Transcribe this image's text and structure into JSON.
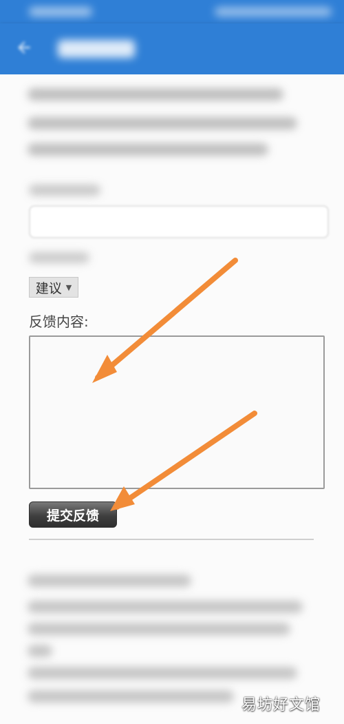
{
  "form": {
    "feedback_type_selected": "建议",
    "feedback_label": "反馈内容:",
    "submit_label": "提交反馈"
  },
  "watermark": "易坊好文馆",
  "colors": {
    "app_bar": "#2f7fd6",
    "arrow": "#f28c38",
    "button_dark": "#333333"
  },
  "icons": {
    "back": "arrow-left-icon",
    "select_arrow": "triangle-down-icon"
  }
}
